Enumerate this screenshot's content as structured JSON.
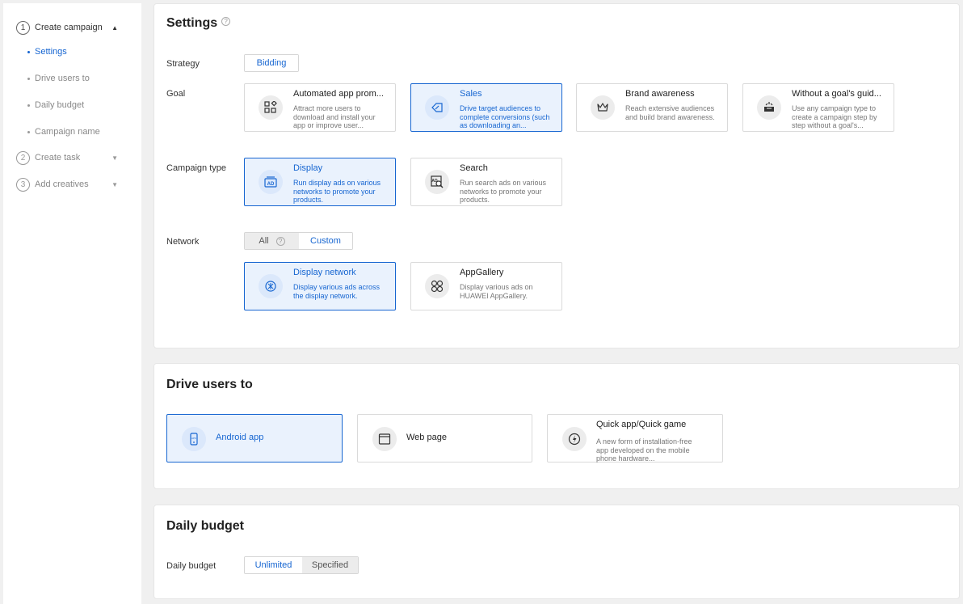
{
  "sidebar": {
    "steps": [
      {
        "num": "1",
        "label": "Create campaign"
      },
      {
        "num": "2",
        "label": "Create task"
      },
      {
        "num": "3",
        "label": "Add creatives"
      }
    ],
    "subitems": [
      "Settings",
      "Drive users to",
      "Daily budget",
      "Campaign name"
    ]
  },
  "settings": {
    "title": "Settings",
    "strategy_label": "Strategy",
    "strategy_value": "Bidding",
    "goal_label": "Goal",
    "goals": [
      {
        "title": "Automated app prom...",
        "desc": "Attract more users to download and install your app or improve user...",
        "icon": "apps-grid-icon"
      },
      {
        "title": "Sales",
        "desc": "Drive target audiences to complete conversions (such as downloading an...",
        "icon": "tag-icon"
      },
      {
        "title": "Brand awareness",
        "desc": "Reach extensive audiences and build brand awareness.",
        "icon": "crown-icon"
      },
      {
        "title": "Without a goal's guid...",
        "desc": "Use any campaign type to create a campaign step by step without a goal's...",
        "icon": "box-icon"
      }
    ],
    "campaign_type_label": "Campaign type",
    "campaign_types": [
      {
        "title": "Display",
        "desc": "Run display ads on various networks to promote your products.",
        "icon": "ad-icon"
      },
      {
        "title": "Search",
        "desc": "Run search ads on various networks to promote your products.",
        "icon": "search-ad-icon"
      }
    ],
    "network_label": "Network",
    "network_options": [
      "All",
      "Custom"
    ],
    "networks": [
      {
        "title": "Display network",
        "desc": "Display various ads across the display network.",
        "icon": "display-network-icon"
      },
      {
        "title": "AppGallery",
        "desc": "Display various ads on HUAWEI AppGallery.",
        "icon": "appgallery-icon"
      }
    ]
  },
  "drive": {
    "title": "Drive users to",
    "options": [
      {
        "title": "Android app",
        "desc": "",
        "icon": "phone-icon"
      },
      {
        "title": "Web page",
        "desc": "",
        "icon": "browser-icon"
      },
      {
        "title": "Quick app/Quick game",
        "desc": "A new form of installation-free app developed on the mobile phone hardware...",
        "icon": "lightning-icon"
      }
    ]
  },
  "budget": {
    "title": "Daily budget",
    "label": "Daily budget",
    "options": [
      "Unlimited",
      "Specified"
    ]
  },
  "colors": {
    "accent": "#1766d1",
    "selected_bg": "#eaf2fd"
  }
}
